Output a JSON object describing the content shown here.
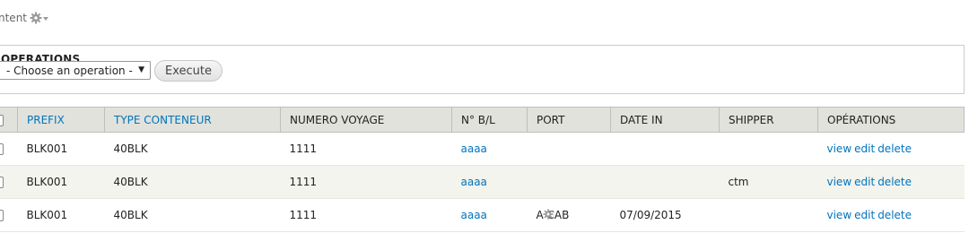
{
  "header": {
    "crumb_label": "ntent"
  },
  "operations": {
    "legend": "OPERATIONS",
    "select_value": "- Choose an operation -",
    "execute_label": "Execute"
  },
  "table": {
    "columns": [
      "PREFIX",
      "TYPE CONTENEUR",
      "NUMERO VOYAGE",
      "N° B/L",
      "PORT",
      "DATE IN",
      "SHIPPER",
      "OPÉRATIONS"
    ],
    "rows": [
      {
        "prefix": "BLK001",
        "type": "40BLK",
        "voyage": "1111",
        "bl": "aaaa",
        "port": "",
        "date_in": "",
        "shipper": "",
        "view": "view",
        "edit": "edit",
        "delete": "delete"
      },
      {
        "prefix": "BLK001",
        "type": "40BLK",
        "voyage": "1111",
        "bl": "aaaa",
        "port": "",
        "date_in": "",
        "shipper": "ctm",
        "view": "view",
        "edit": "edit",
        "delete": "delete"
      },
      {
        "prefix": "BLK001",
        "type": "40BLK",
        "voyage": "1111",
        "bl": "aaaa",
        "port": "A CAB",
        "date_in": "07/09/2015",
        "shipper": "",
        "view": "view",
        "edit": "edit",
        "delete": "delete"
      }
    ]
  }
}
